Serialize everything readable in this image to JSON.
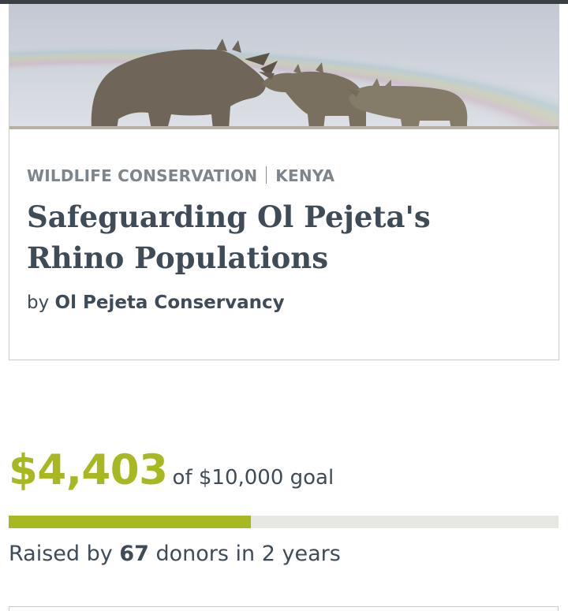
{
  "project": {
    "category": "WILDLIFE CONSERVATION",
    "location": "KENYA",
    "title": "Safeguarding Ol Pejeta's Rhino Populations",
    "by_prefix": "by",
    "organization": "Ol Pejeta Conservancy",
    "hero_image": "rhino-family-photo"
  },
  "funding": {
    "raised": "$4,403",
    "goal_text": "of $10,000 goal",
    "progress_fraction": 0.4403,
    "donors_prefix": "Raised by",
    "donor_count": "67",
    "donors_suffix": "donors in 2 years"
  },
  "colors": {
    "accent": "#a7b821",
    "text": "#3f4b57",
    "muted": "#7d848b",
    "track": "#e7e7e4"
  }
}
